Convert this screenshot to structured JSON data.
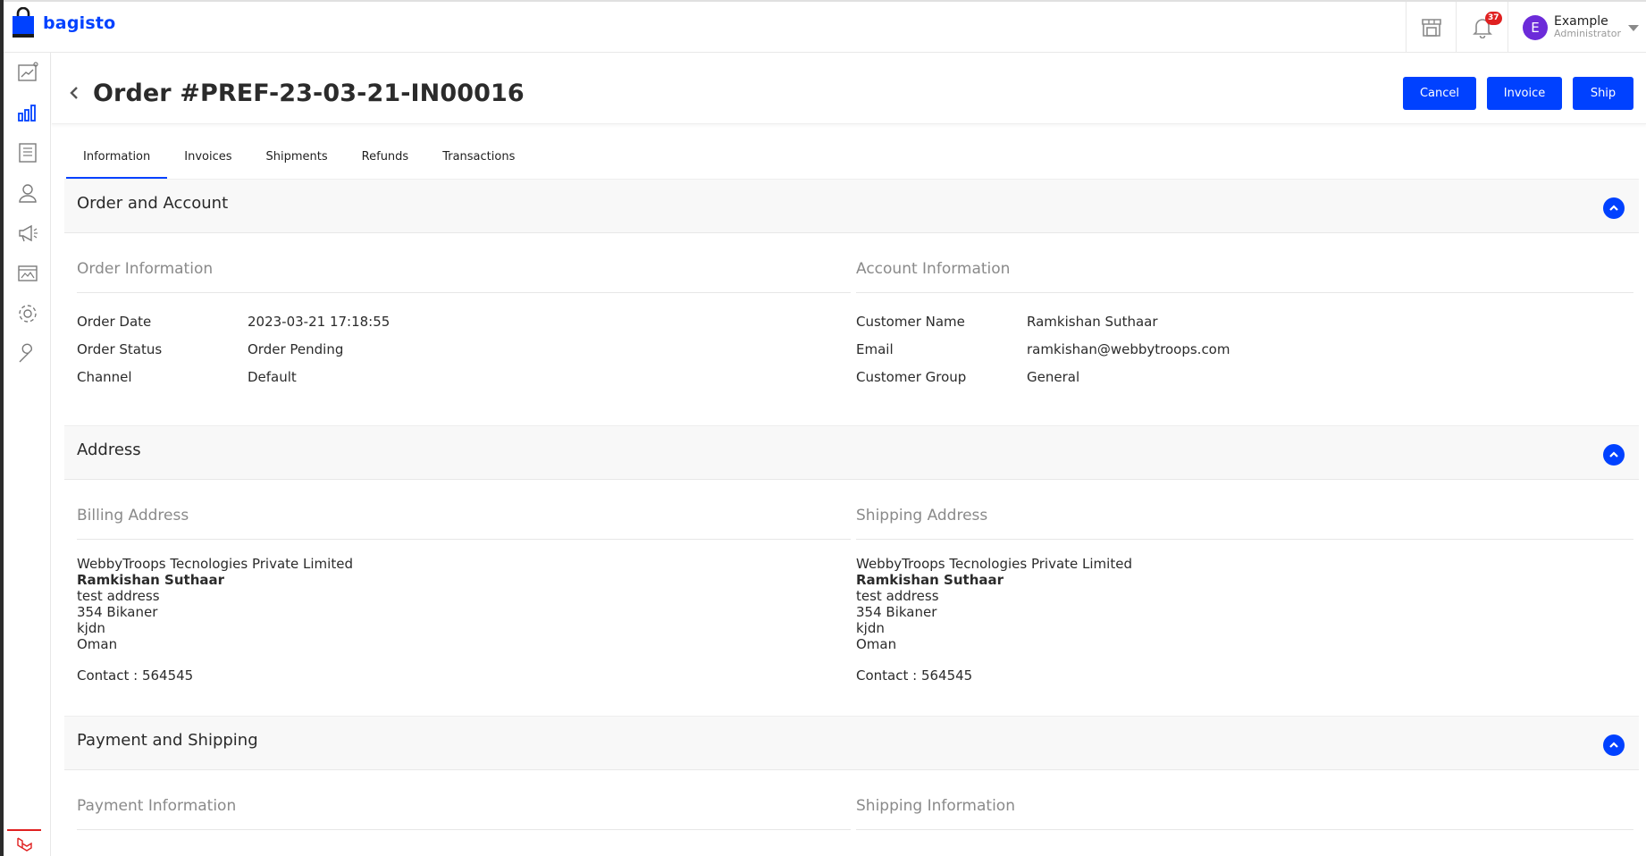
{
  "header": {
    "logo_text": "bagisto",
    "notification_count": "37",
    "user": {
      "initial": "E",
      "name": "Example",
      "role": "Administrator"
    }
  },
  "sidebar": {
    "items": [
      "dashboard-icon",
      "sales-icon",
      "catalog-icon",
      "customers-icon",
      "marketing-icon",
      "cms-icon",
      "settings-icon",
      "configure-icon"
    ]
  },
  "page": {
    "title": "Order #PREF-23-03-21-IN00016",
    "actions": {
      "cancel": "Cancel",
      "invoice": "Invoice",
      "ship": "Ship"
    },
    "tabs": [
      "Information",
      "Invoices",
      "Shipments",
      "Refunds",
      "Transactions"
    ],
    "active_tab": "Information"
  },
  "order_account": {
    "title": "Order and Account",
    "order_info": {
      "title": "Order Information",
      "rows": [
        {
          "label": "Order Date",
          "value": "2023-03-21 17:18:55"
        },
        {
          "label": "Order Status",
          "value": "Order Pending"
        },
        {
          "label": "Channel",
          "value": "Default"
        }
      ]
    },
    "account_info": {
      "title": "Account Information",
      "rows": [
        {
          "label": "Customer Name",
          "value": "Ramkishan Suthaar"
        },
        {
          "label": "Email",
          "value": "ramkishan@webbytroops.com"
        },
        {
          "label": "Customer Group",
          "value": "General"
        }
      ]
    }
  },
  "address": {
    "title": "Address",
    "billing": {
      "title": "Billing Address",
      "company": "WebbyTroops Tecnologies Private Limited",
      "name": "Ramkishan Suthaar",
      "line1": "test address",
      "line2": "354 Bikaner",
      "line3": "kjdn",
      "country": "Oman",
      "contact": "Contact : 564545"
    },
    "shipping": {
      "title": "Shipping Address",
      "company": "WebbyTroops Tecnologies Private Limited",
      "name": "Ramkishan Suthaar",
      "line1": "test address",
      "line2": "354 Bikaner",
      "line3": "kjdn",
      "country": "Oman",
      "contact": "Contact : 564545"
    }
  },
  "payment_shipping": {
    "title": "Payment and Shipping",
    "payment_title": "Payment Information",
    "shipping_title": "Shipping Information"
  },
  "colors": {
    "accent": "#0041ff",
    "badge": "#e02020",
    "avatar": "#6c2bd9"
  }
}
